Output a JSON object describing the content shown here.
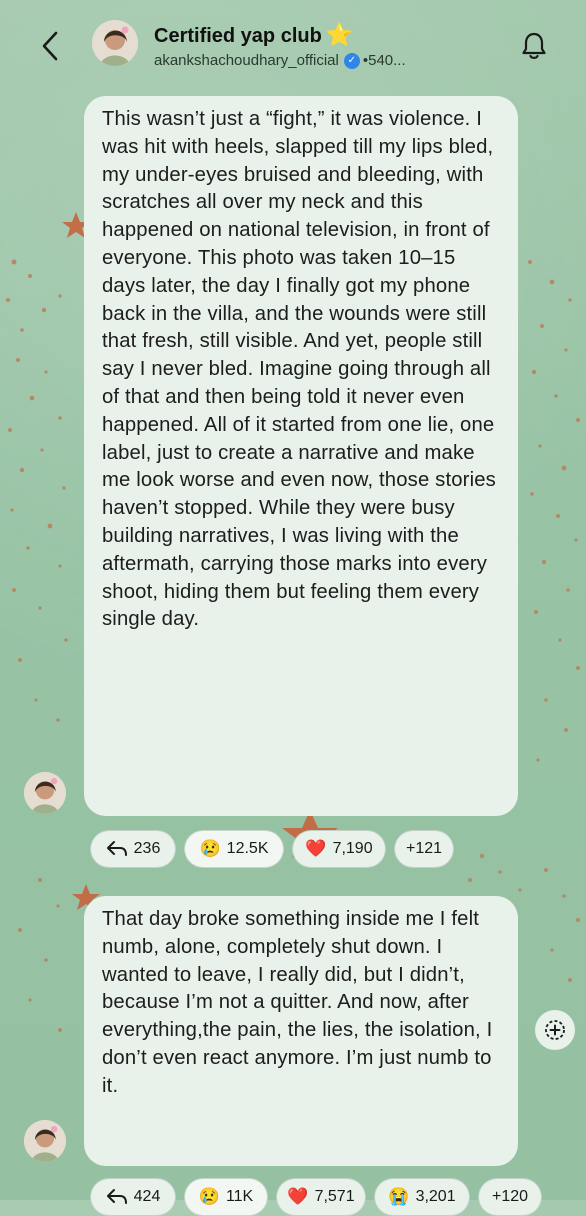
{
  "header": {
    "title": "Certified yap club",
    "title_emoji": "⭐",
    "account": "akankshachoudhary_official",
    "member_count": "•540..."
  },
  "messages": [
    {
      "text": "This wasn’t just a “fight,” it was violence. I was hit with heels, slapped till my lips bled, my under-eyes bruised and bleeding, with scratches all over my neck and this happened on national television, in front of everyone. This photo was taken 10–15 days later, the day I finally got my phone back in the villa, and the wounds were still that fresh, still visible. And yet, people still say I never bled. Imagine going through all of that and then being told it never even happened. All of it started from one lie, one label, just to create a narrative and make me look worse and even now, those stories haven’t stopped. While they were busy building narratives, I was living with the aftermath, carrying those marks into every shoot, hiding them but feeling them every single day.",
      "replies": "236",
      "reactions": [
        {
          "emoji": "😢",
          "count": "12.5K",
          "active": true
        },
        {
          "emoji": "❤️",
          "count": "7,190",
          "active": false
        }
      ],
      "more": "+121"
    },
    {
      "text": "That day broke something inside me I felt numb, alone, completely shut down. I wanted to leave, I really did, but I didn’t, because I’m not a quitter. And now, after everything,the pain, the lies, the isolation, I don’t even react anymore. I’m just numb to it.",
      "replies": "424",
      "reactions": [
        {
          "emoji": "😢",
          "count": "11K",
          "active": true
        },
        {
          "emoji": "❤️",
          "count": "7,571",
          "active": false
        },
        {
          "emoji": "😭",
          "count": "3,201",
          "active": false
        }
      ],
      "more": "+120"
    }
  ],
  "colors": {
    "background": "#9cc5a8",
    "bubble": "#e8f1ea",
    "verified": "#2f86e8",
    "star": "#f5c518"
  },
  "icons": {
    "back": "chevron-left-icon",
    "bell": "bell-icon",
    "reply": "reply-arrow-icon",
    "add_reaction": "add-reaction-icon"
  }
}
